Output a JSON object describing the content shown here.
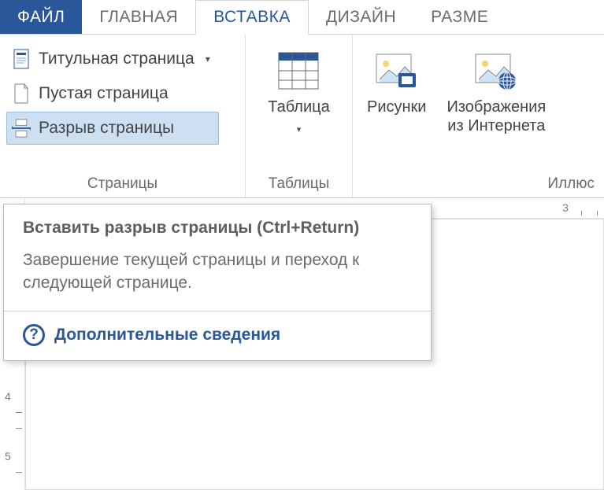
{
  "tabs": {
    "file": "ФАЙЛ",
    "home": "ГЛАВНАЯ",
    "insert": "ВСТАВКА",
    "design": "ДИЗАЙН",
    "size": "РАЗМЕ"
  },
  "groups": {
    "pages": {
      "label": "Страницы"
    },
    "tables": {
      "label": "Таблицы"
    },
    "illus": {
      "label": "Иллюс"
    }
  },
  "pages_items": {
    "cover": "Титульная страница",
    "blank": "Пустая страница",
    "break": "Разрыв страницы"
  },
  "buttons": {
    "table": {
      "line1": "Таблица"
    },
    "pictures": {
      "line1": "Рисунки"
    },
    "online_pic": {
      "line1": "Изображения",
      "line2": "из Интернета"
    }
  },
  "tooltip": {
    "title": "Вставить разрыв страницы (Ctrl+Return)",
    "body": "Завершение текущей страницы и переход к следующей странице.",
    "more": "Дополнительные сведения"
  },
  "ruler": {
    "h_num": "3",
    "v_nums": [
      "4",
      "5"
    ]
  }
}
